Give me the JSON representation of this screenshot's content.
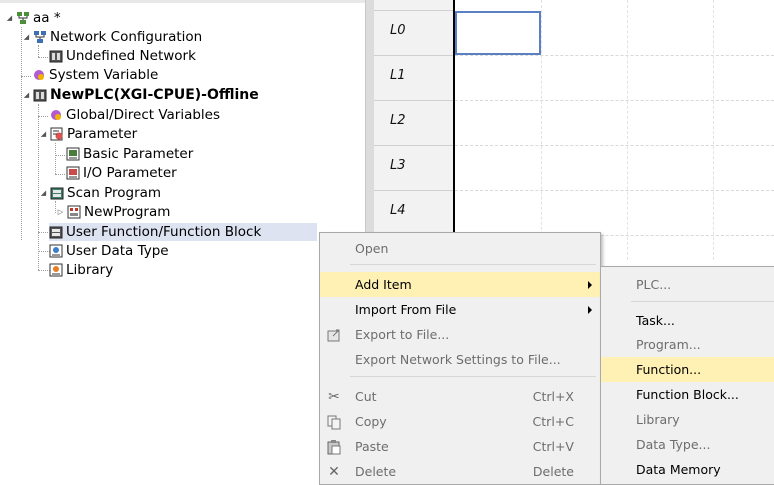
{
  "tree": {
    "project": "aa *",
    "network_config": "Network Configuration",
    "undefined_network": "Undefined Network",
    "system_variable": "System Variable",
    "plc": "NewPLC(XGI-CPUE)-Offline",
    "global_vars": "Global/Direct Variables",
    "parameter": "Parameter",
    "basic_param": "Basic Parameter",
    "io_param": "I/O Parameter",
    "scan_program": "Scan Program",
    "new_program": "NewProgram",
    "user_fb": "User Function/Function Block",
    "user_data_type": "User Data Type",
    "library": "Library"
  },
  "ladder": {
    "rungs": [
      "L0",
      "L1",
      "L2",
      "L3",
      "L4"
    ]
  },
  "context_menu": {
    "open": "Open",
    "add_item": "Add Item",
    "import_from_file": "Import From File",
    "export_to_file": "Export to File...",
    "export_network": "Export Network Settings to File...",
    "cut": "Cut",
    "cut_shortcut": "Ctrl+X",
    "copy": "Copy",
    "copy_shortcut": "Ctrl+C",
    "paste": "Paste",
    "paste_shortcut": "Ctrl+V",
    "delete": "Delete",
    "delete_shortcut": "Delete"
  },
  "submenu": {
    "plc": "PLC...",
    "task": "Task...",
    "program": "Program...",
    "function": "Function...",
    "function_block": "Function Block...",
    "library": "Library",
    "data_type": "Data Type...",
    "data_memory": "Data Memory"
  },
  "colors": {
    "highlight": "#fff0b4",
    "selection": "#dde3f1",
    "cursor": "#5b7fc3"
  }
}
